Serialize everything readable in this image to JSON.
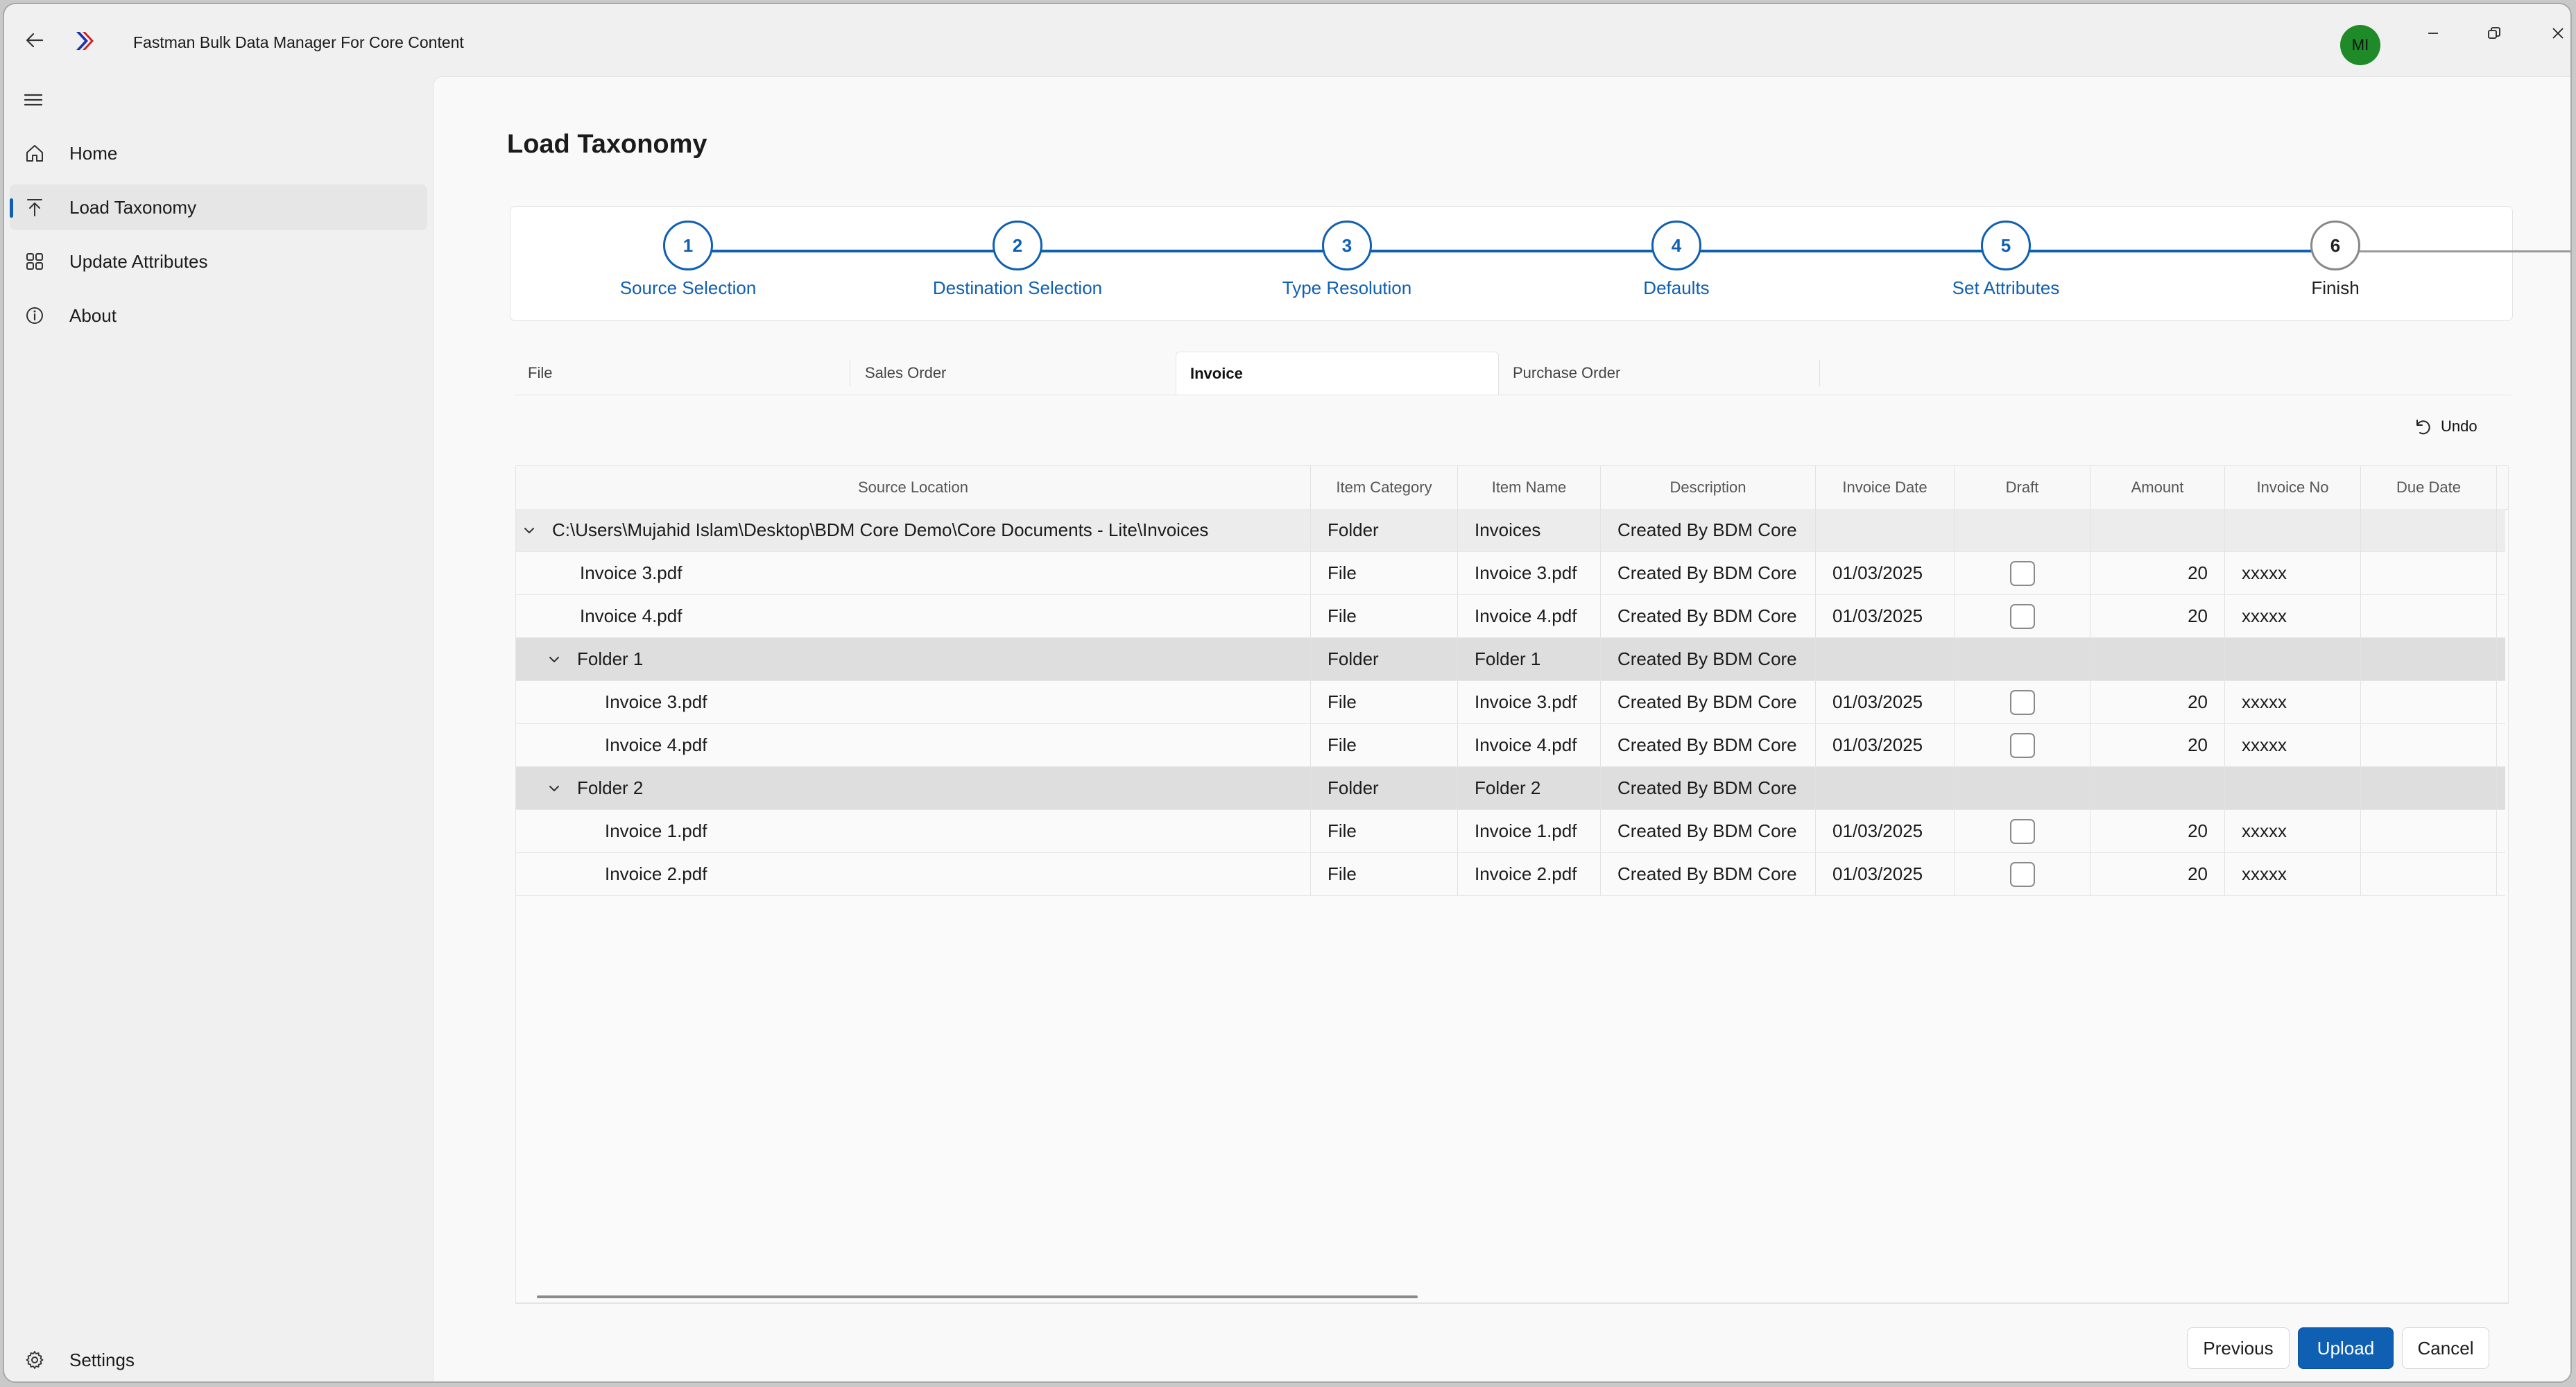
{
  "app": {
    "title": "Fastman Bulk Data Manager For Core Content",
    "avatar_initials": "MI",
    "accent_color": "#0f5fb3"
  },
  "nav": {
    "items": [
      {
        "label": "Home",
        "icon": "home-icon",
        "active": false
      },
      {
        "label": "Load Taxonomy",
        "icon": "upload-icon",
        "active": true
      },
      {
        "label": "Update Attributes",
        "icon": "grid-icon",
        "active": false
      },
      {
        "label": "About",
        "icon": "info-icon",
        "active": false
      }
    ],
    "settings_label": "Settings"
  },
  "page": {
    "title": "Load Taxonomy"
  },
  "stepper": {
    "steps": [
      {
        "number": "1",
        "label": "Source Selection",
        "done": true
      },
      {
        "number": "2",
        "label": "Destination Selection",
        "done": true
      },
      {
        "number": "3",
        "label": "Type Resolution",
        "done": true
      },
      {
        "number": "4",
        "label": "Defaults",
        "done": true
      },
      {
        "number": "5",
        "label": "Set Attributes",
        "done": true
      },
      {
        "number": "6",
        "label": "Finish",
        "done": false
      }
    ]
  },
  "tabs": {
    "items": [
      "File",
      "Sales Order",
      "Invoice",
      "Purchase Order"
    ],
    "active": "Invoice"
  },
  "toolbar": {
    "undo_label": "Undo"
  },
  "grid": {
    "columns": [
      "Source Location",
      "Item Category",
      "Item Name",
      "Description",
      "Invoice Date",
      "Draft",
      "Amount",
      "Invoice No",
      "Due Date"
    ],
    "rows": [
      {
        "level": 0,
        "group": true,
        "source": "C:\\Users\\Mujahid Islam\\Desktop\\BDM Core Demo\\Core Documents - Lite\\Invoices",
        "category": "Folder",
        "name": "Invoices",
        "description": "Created By BDM Core",
        "date": "",
        "amount": "",
        "invoice_no": ""
      },
      {
        "level": 1,
        "group": false,
        "source": "Invoice 3.pdf",
        "category": "File",
        "name": "Invoice 3.pdf",
        "description": "Created By BDM Core",
        "date": "01/03/2025",
        "amount": "20",
        "invoice_no": "xxxxx"
      },
      {
        "level": 1,
        "group": false,
        "source": "Invoice 4.pdf",
        "category": "File",
        "name": "Invoice 4.pdf",
        "description": "Created By BDM Core",
        "date": "01/03/2025",
        "amount": "20",
        "invoice_no": "xxxxx"
      },
      {
        "level": 1,
        "group": true,
        "source": "Folder 1",
        "category": "Folder",
        "name": "Folder 1",
        "description": "Created By BDM Core",
        "date": "",
        "amount": "",
        "invoice_no": ""
      },
      {
        "level": 2,
        "group": false,
        "source": "Invoice 3.pdf",
        "category": "File",
        "name": "Invoice 3.pdf",
        "description": "Created By BDM Core",
        "date": "01/03/2025",
        "amount": "20",
        "invoice_no": "xxxxx"
      },
      {
        "level": 2,
        "group": false,
        "source": "Invoice 4.pdf",
        "category": "File",
        "name": "Invoice 4.pdf",
        "description": "Created By BDM Core",
        "date": "01/03/2025",
        "amount": "20",
        "invoice_no": "xxxxx"
      },
      {
        "level": 1,
        "group": true,
        "source": "Folder 2",
        "category": "Folder",
        "name": "Folder 2",
        "description": "Created By BDM Core",
        "date": "",
        "amount": "",
        "invoice_no": ""
      },
      {
        "level": 2,
        "group": false,
        "source": "Invoice 1.pdf",
        "category": "File",
        "name": "Invoice 1.pdf",
        "description": "Created By BDM Core",
        "date": "01/03/2025",
        "amount": "20",
        "invoice_no": "xxxxx"
      },
      {
        "level": 2,
        "group": false,
        "source": "Invoice 2.pdf",
        "category": "File",
        "name": "Invoice 2.pdf",
        "description": "Created By BDM Core",
        "date": "01/03/2025",
        "amount": "20",
        "invoice_no": "xxxxx"
      }
    ]
  },
  "footer": {
    "previous_label": "Previous",
    "upload_label": "Upload",
    "cancel_label": "Cancel"
  }
}
